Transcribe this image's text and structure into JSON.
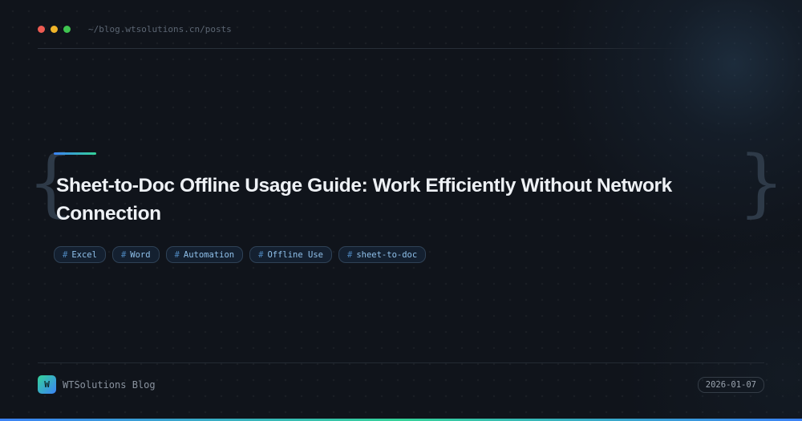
{
  "window": {
    "path": "~/blog.wtsolutions.cn/posts",
    "traffic_lights": [
      "#ed5b52",
      "#f0b429",
      "#3fc550"
    ]
  },
  "decor": {
    "brace_left": "{",
    "brace_right": "}"
  },
  "post": {
    "title": "Sheet-to-Doc Offline Usage Guide: Work Efficiently Without Network Connection",
    "tags": [
      {
        "hash": "#",
        "label": "Excel"
      },
      {
        "hash": "#",
        "label": "Word"
      },
      {
        "hash": "#",
        "label": "Automation"
      },
      {
        "hash": "#",
        "label": "Offline Use"
      },
      {
        "hash": "#",
        "label": "sheet-to-doc"
      }
    ]
  },
  "footer": {
    "logo_letter": "W",
    "brand": "WTSolutions Blog",
    "date": "2026-01-07"
  },
  "colors": {
    "accent_start": "#3b82f6",
    "accent_end": "#34d399"
  }
}
